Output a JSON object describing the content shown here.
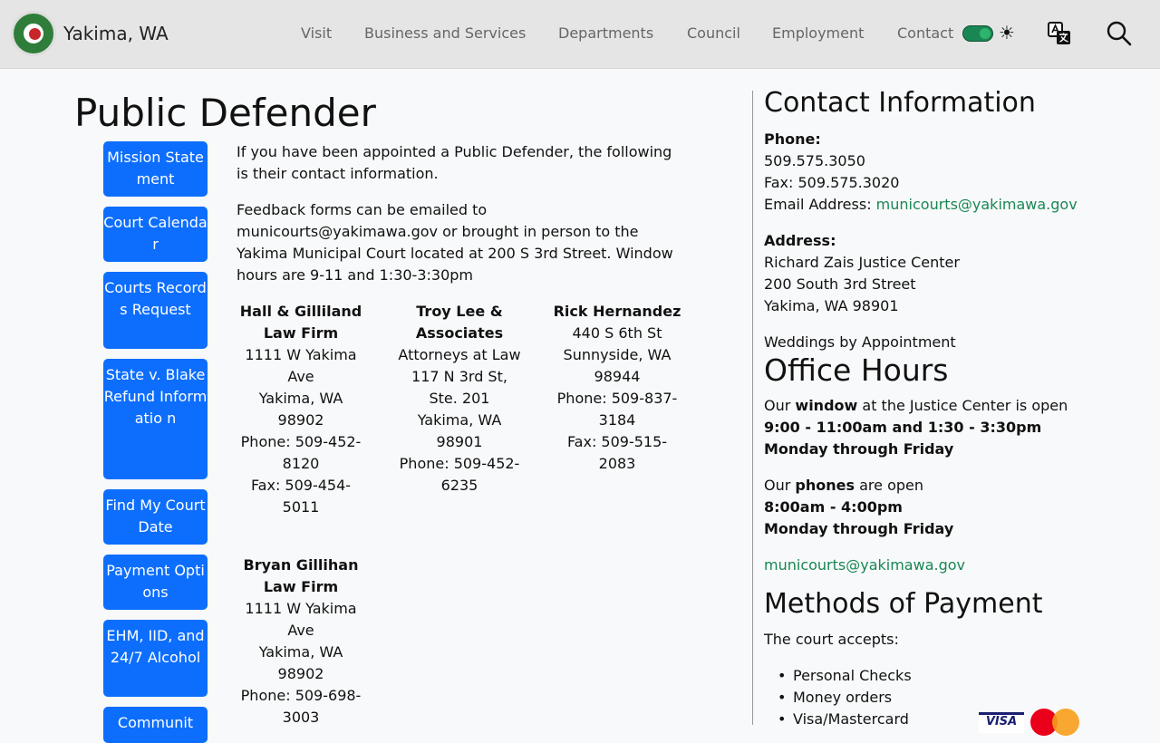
{
  "nav": {
    "site_name": "Yakima, WA",
    "items": [
      "Visit",
      "Business and Services",
      "Departments",
      "Council",
      "Employment",
      "Contact"
    ],
    "icons": [
      "toggle-switch",
      "sun-icon",
      "translate-icon",
      "search-icon"
    ]
  },
  "page_title": "Public Defender",
  "sidebar": [
    "Mission Statement",
    "Court Calendar",
    "Courts Records Request",
    "State v. Blake Refund Informatio n",
    "Find My Court Date",
    "Payment Options",
    "EHM, IID, and 24/7 Alcohol",
    "Communit"
  ],
  "main": {
    "intro": "If you have been appointed a Public Defender, the following is their contact information.",
    "feedback": "Feedback forms can be emailed to municourts@yakimawa.gov or brought in person to the Yakima Municipal Court located at 200 S 3rd Street. Window hours are 9-11 and 1:30-3:30pm",
    "firms": [
      {
        "name": [
          "Hall & Gilliland",
          "Law Firm"
        ],
        "lines": [
          "1111 W Yakima",
          "Ave",
          "Yakima, WA",
          "98902",
          "Phone: 509-452-",
          "8120",
          "Fax: 509-454-",
          "5011"
        ]
      },
      {
        "name": [
          "Troy Lee &",
          "Associates"
        ],
        "lines": [
          "Attorneys at Law",
          "117 N 3rd St,",
          "Ste. 201",
          "Yakima, WA",
          "98901",
          "Phone: 509-452-",
          "6235"
        ]
      },
      {
        "name": [
          "Rick Hernandez"
        ],
        "lines": [
          "440 S 6th St",
          "Sunnyside, WA",
          "98944",
          "Phone: 509-837-",
          "3184",
          "Fax: 509-515-",
          "2083"
        ]
      },
      {
        "name": [
          "Bryan Gillihan",
          "Law Firm"
        ],
        "lines": [
          "1111 W Yakima",
          "Ave",
          "Yakima, WA",
          "98902",
          "Phone: 509-698-",
          "3003"
        ]
      }
    ]
  },
  "contact": {
    "heading": "Contact Information",
    "phone_label": "Phone:",
    "phone": "509.575.3050",
    "fax": "Fax: 509.575.3020",
    "email_label": "Email Address: ",
    "email": "municourts@yakimawa.gov",
    "address_label": "Address:",
    "address": [
      "Richard Zais Justice Center",
      "200 South 3rd Street",
      "Yakima, WA 98901"
    ],
    "weddings": "Weddings by Appointment"
  },
  "office_hours": {
    "heading": "Office Hours",
    "window_pre": "Our ",
    "window_bold": "window",
    "window_post": " at the Justice Center is open",
    "window_hours": "9:00 - 11:00am and 1:30 - 3:30pm",
    "window_days": "Monday through Friday",
    "phones_pre": "Our ",
    "phones_bold": "phones",
    "phones_post": " are open",
    "phones_hours": "8:00am - 4:00pm",
    "phones_days": "Monday through Friday",
    "email": "municourts@yakimawa.gov"
  },
  "payment": {
    "heading": "Methods of Payment",
    "intro": "The court accepts:",
    "methods": [
      "Personal Checks",
      "Money orders",
      "Visa/Mastercard"
    ],
    "card_logos": [
      "visa-logo",
      "mastercard-logo"
    ],
    "visa_text": "VISA"
  }
}
